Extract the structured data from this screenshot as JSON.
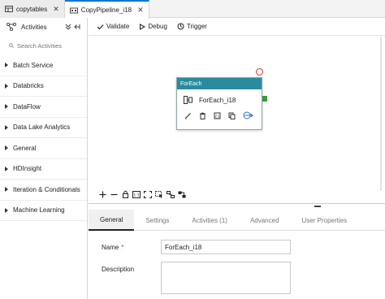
{
  "tabs": [
    {
      "label": "copytables",
      "icon": "dataset-icon",
      "active": false
    },
    {
      "label": "CopyPipeline_i18",
      "icon": "pipeline-icon",
      "active": true
    }
  ],
  "tab_close_glyph": "✕",
  "left_panel": {
    "title": "Activities",
    "search_placeholder": "Search Activities",
    "categories": [
      "Batch Service",
      "Databricks",
      "DataFlow",
      "Data Lake Analytics",
      "General",
      "HDInsight",
      "Iteration & Conditionals",
      "Machine Learning"
    ]
  },
  "toolbar": {
    "validate": "Validate",
    "debug": "Debug",
    "trigger": "Trigger"
  },
  "node": {
    "header": "ForEach",
    "name": "ForEach_i18",
    "header_color": "#2a8ba0",
    "port_color": "#3c9a3c",
    "error_color": "#d13438"
  },
  "properties": {
    "tabs": [
      "General",
      "Settings",
      "Activities (1)",
      "Advanced",
      "User Properties"
    ],
    "active_tab": "General",
    "name_label": "Name",
    "required_mark": "*",
    "name_value": "ForEach_i18",
    "description_label": "Description"
  },
  "colors": {
    "accent": "#0078d4"
  }
}
